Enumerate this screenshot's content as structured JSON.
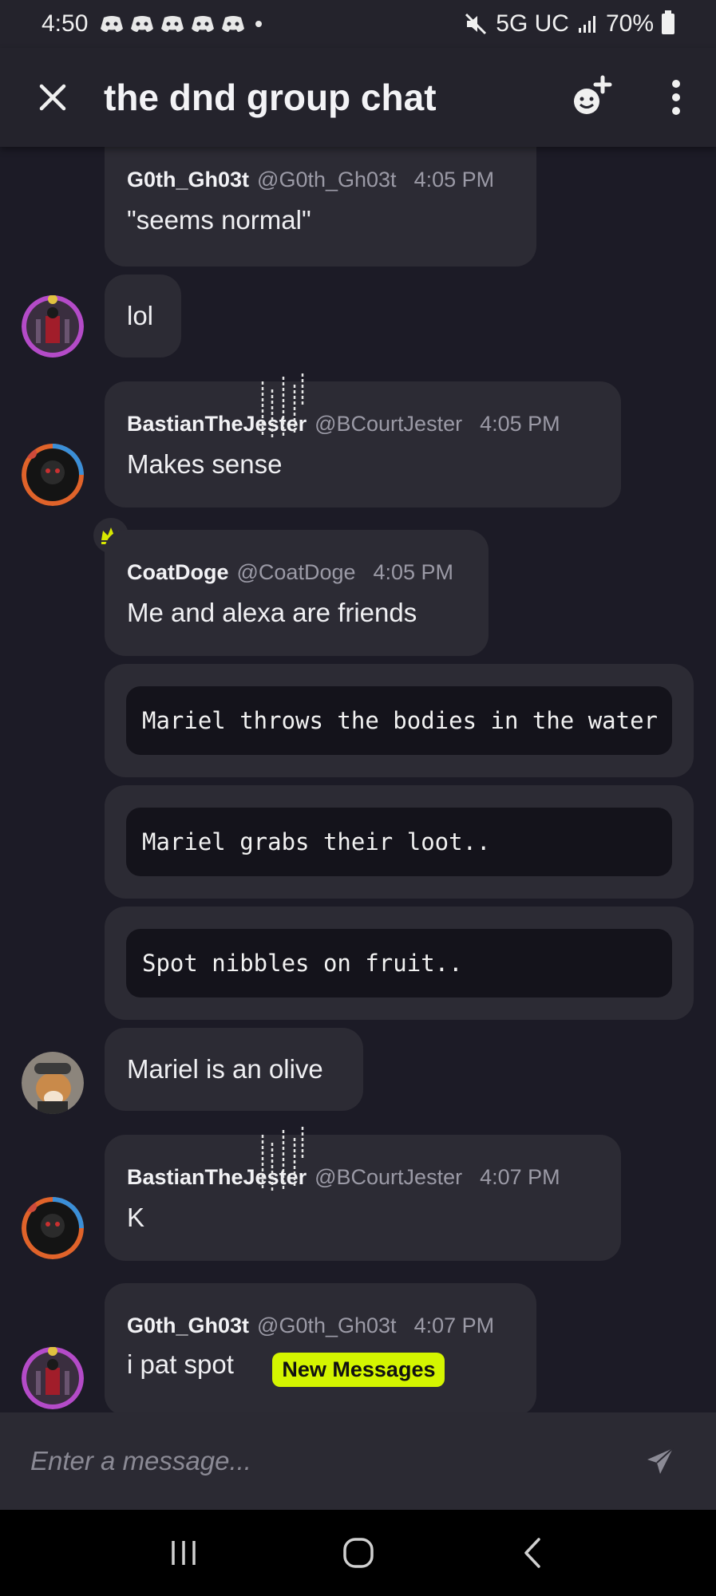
{
  "status_bar": {
    "time": "4:50",
    "network": "5G UC",
    "battery": "70%",
    "icons": [
      "discord-icon",
      "discord-icon",
      "discord-icon",
      "discord-icon",
      "discord-icon",
      "dot",
      "mute-icon",
      "signal-icon",
      "battery-icon"
    ]
  },
  "header": {
    "title": "the dnd group chat",
    "icons": [
      "close-icon",
      "add-emoji-icon",
      "more-options-icon"
    ]
  },
  "messages": [
    {
      "author": "G0th_Gh03t",
      "handle": "@G0th_Gh03t",
      "time": "4:05 PM",
      "text": "\"seems normal\""
    },
    {
      "text": "lol"
    },
    {
      "author": "BastianTheJester",
      "handle": "@BCourtJester",
      "time": "4:05 PM",
      "text": "Makes sense"
    },
    {
      "author": "CoatDoge",
      "handle": "@CoatDoge",
      "time": "4:05 PM",
      "text": "Me and alexa are friends"
    },
    {
      "code": "Mariel throws the bodies in the water"
    },
    {
      "code": "Mariel grabs their loot.."
    },
    {
      "code": "Spot nibbles on fruit.."
    },
    {
      "text": "Mariel is an olive"
    },
    {
      "author": "BastianTheJester",
      "handle": "@BCourtJester",
      "time": "4:07 PM",
      "text": "K"
    },
    {
      "author": "G0th_Gh03t",
      "handle": "@G0th_Gh03t",
      "time": "4:07 PM",
      "text": "i pat spot"
    }
  ],
  "badge": "New Messages",
  "composer": {
    "placeholder": "Enter a message..."
  },
  "colors": {
    "background": "#1c1b26",
    "bubble": "#2c2b34",
    "code": "#14131b",
    "badge": "#d4f500"
  }
}
